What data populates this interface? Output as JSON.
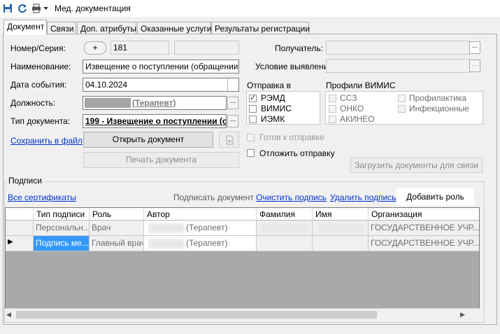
{
  "window": {
    "title": "Мед. документация",
    "icons": [
      "save-icon",
      "refresh-icon",
      "print-icon",
      "dropdown-arrow-icon"
    ]
  },
  "tabs": [
    {
      "label": "Документ",
      "active": true
    },
    {
      "label": "Связи",
      "active": false
    },
    {
      "label": "Доп. атрибуты",
      "active": false
    },
    {
      "label": "Оказанные услуги",
      "active": false
    },
    {
      "label": "Результаты регистрации",
      "active": false
    }
  ],
  "form": {
    "number_label": "Номер/Серия:",
    "number_btn": "+",
    "number_value": "181",
    "series_value": "",
    "name_label": "Наименование:",
    "name_value": "Извещение о поступлении (обращении) пациента",
    "event_date_label": "Дата события:",
    "event_date_value": "04.10.2024",
    "position_label": "Должность:",
    "position_value": "(Терапевт)",
    "doctype_label": "Тип документа:",
    "doctype_value": "199 - Извещение о поступлении (о",
    "save_file_link": "Сохранить в файл",
    "open_doc_btn": "Открыть документ",
    "print_doc_btn": "Печать документа",
    "ellipsis": "..."
  },
  "right": {
    "recipient_label": "Получатель:",
    "recipient_value": "",
    "condition_label": "Условие выявления:",
    "condition_value": "",
    "send_to_label": "Отправка в",
    "send_to": [
      {
        "label": "РЭМД",
        "checked": true
      },
      {
        "label": "ВИМИС",
        "checked": false
      },
      {
        "label": "ИЭМК",
        "checked": false
      }
    ],
    "profiles_label": "Профили ВИМИС",
    "profiles_col1": [
      {
        "label": "ССЗ",
        "checked": false
      },
      {
        "label": "ОНКО",
        "checked": false
      },
      {
        "label": "АКИНЕО",
        "checked": false
      }
    ],
    "profiles_col2": [
      {
        "label": "Профилактика",
        "checked": false
      },
      {
        "label": "Инфекционные",
        "checked": false
      }
    ],
    "ready_to_send_label": "Готов к отправке",
    "postpone_send_label": "Отложить отправку",
    "load_docs_btn": "Загрузить документы для связи"
  },
  "signatures": {
    "group_label": "Подписи",
    "all_certs_link": "Все сертификаты",
    "sign_doc_text": "Подписать документ",
    "clear_sign_link": "Очистить подпись",
    "delete_sign_link": "Удалить подпись",
    "add_role_btn": "Добавить роль",
    "columns": [
      "Тип подписи",
      "Роль",
      "Автор",
      "Фамилия",
      "Имя",
      "Организация"
    ],
    "rows": [
      {
        "indicator": "",
        "type": "Персональн...",
        "role": "Врач",
        "author": "(Терапевт)",
        "surname": "",
        "name": "",
        "org": "ГОСУДАРСТВЕННОЕ УЧР..."
      },
      {
        "indicator": "▶",
        "type": "Подпись ме...",
        "role": "Главный врач",
        "author": "(Терапевт)",
        "surname": "",
        "name": "",
        "org": "ГОСУДАРСТВЕННОЕ УЧР..."
      }
    ]
  }
}
